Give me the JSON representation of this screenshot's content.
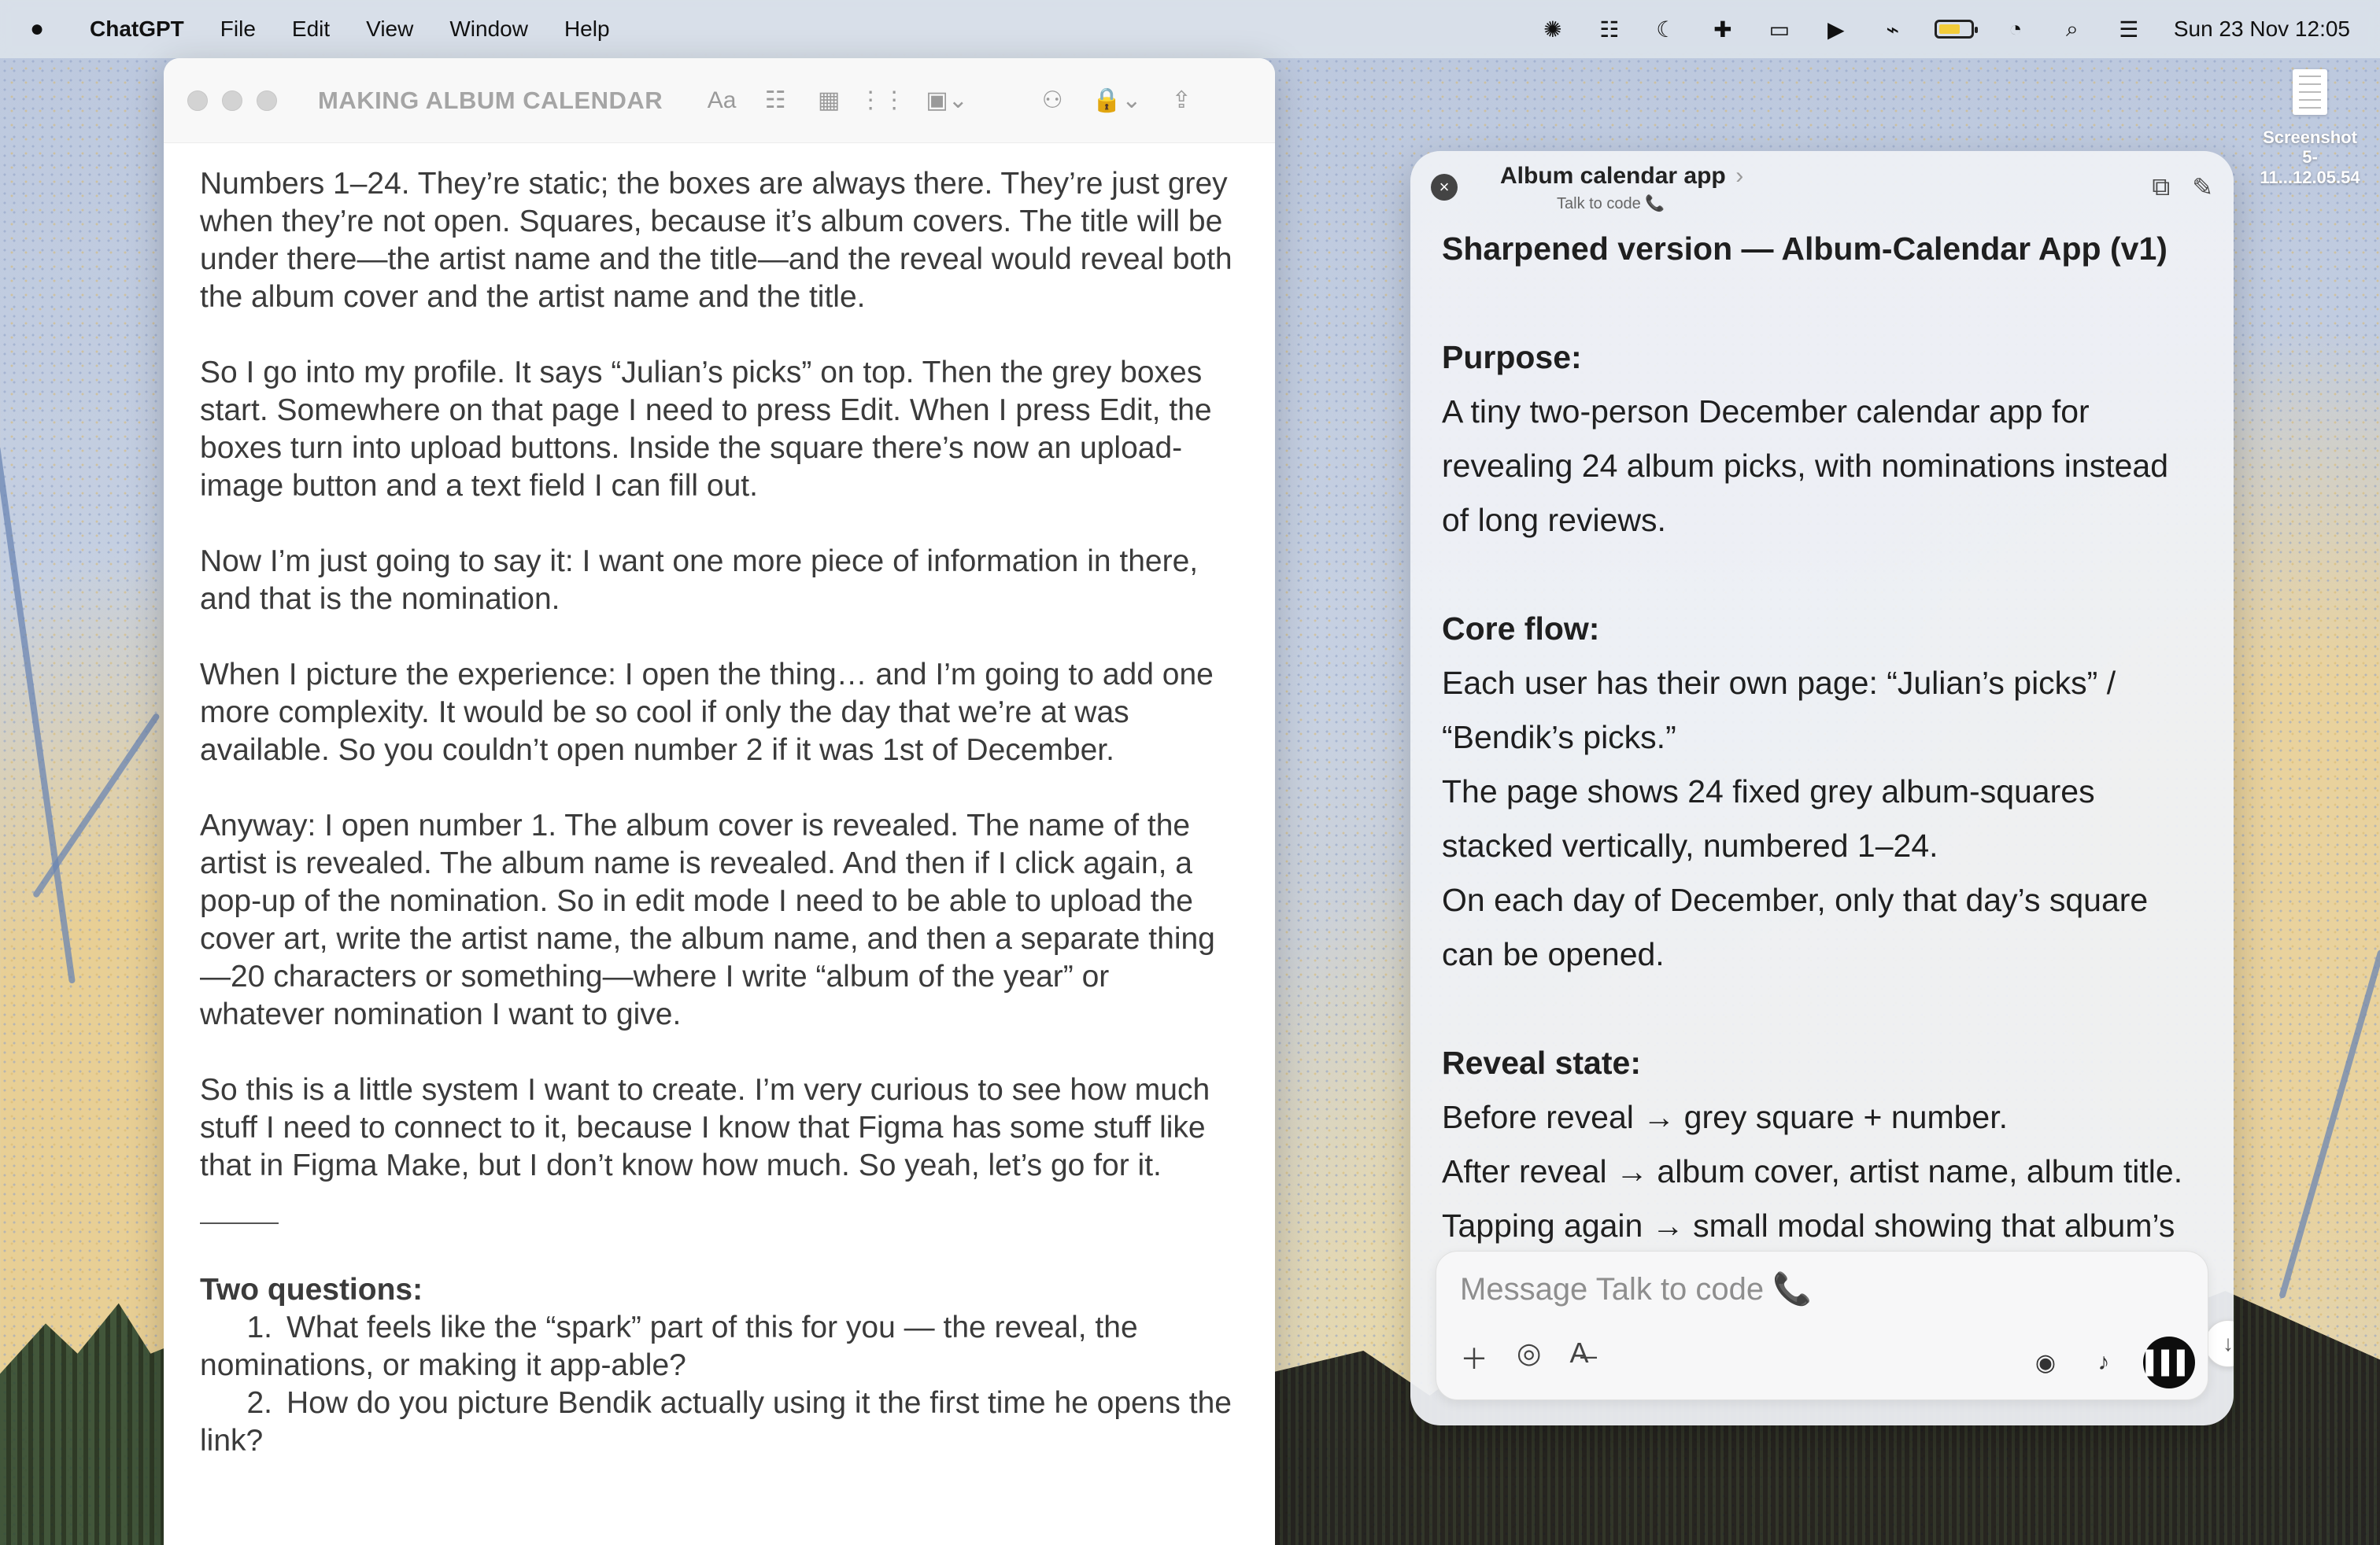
{
  "menubar": {
    "apple": "",
    "app": "ChatGPT",
    "items": [
      "File",
      "Edit",
      "View",
      "Window",
      "Help"
    ],
    "datetime": "Sun 23 Nov  12:05"
  },
  "desktop": {
    "file_label": "Screenshot\n5-11...12.05.54"
  },
  "notes": {
    "title": "MAKING ALBUM CALENDAR",
    "toolbar_icons": [
      "format-icon",
      "checklist-icon",
      "table-icon",
      "audio-icon",
      "media-icon",
      "collaborate-icon",
      "lock-icon",
      "share-icon"
    ],
    "paragraphs": [
      "Numbers 1–24. They’re static; the boxes are always there. They’re just grey when they’re not open. Squares, because it’s album covers. The title will be under there—the artist name and the title—and the reveal would reveal both the album cover and the artist name and the title.",
      "So I go into my profile. It says “Julian’s picks” on top. Then the grey boxes start. Somewhere on that page I need to press Edit. When I press Edit, the boxes turn into upload buttons. Inside the square there’s now an upload-image button and a text field I can fill out.",
      "Now I’m just going to say it: I want one more piece of information in there, and that is the nomination.",
      "When I picture the experience: I open the thing… and I’m going to add one more complexity. It would be so cool if only the day that we’re at was available. So you couldn’t open number 2 if it was 1st of December.",
      "Anyway: I open number 1. The album cover is revealed. The name of the artist is revealed. The album name is revealed. And then if I click again, a pop-up of the nomination. So in edit mode I need to be able to upload the cover art, write the artist name, the album name, and then a separate thing —20 characters or something—where I write “album of the year” or whatever nomination I want to give.",
      "So this is a little system I want to create. I’m very curious to see how much stuff I need to connect to it, because I know that Figma has some stuff like that in Figma Make, but I don’t know how much. So yeah, let’s go for it."
    ],
    "questions_title": "Two questions:",
    "questions": [
      {
        "num": "1.",
        "text": "What feels like the “spark” part of this for you — the reveal, the nominations, or making it app-able?"
      },
      {
        "num": "2.",
        "text": "How do you picture Bendik actually using it the first time he opens the link?"
      }
    ]
  },
  "chat": {
    "title": "Album calendar app",
    "title_chevron": "›",
    "subtitle": "Talk to code 📞",
    "content": {
      "heading": "Sharpened version — Album-Calendar App (v1)",
      "purpose_title": "Purpose:",
      "purpose_text": "A tiny two-person December calendar app for revealing 24 album picks, with nominations instead of long reviews.",
      "core_title": "Core flow:",
      "core_1": "Each user has their own page: “Julian’s picks” / “Bendik’s picks.”",
      "core_2": "The page shows 24 fixed grey album-squares stacked vertically, numbered 1–24.",
      "core_3": "On each day of December, only that day’s square can be opened.",
      "reveal_title": "Reveal state:",
      "reveal_1": "Before reveal → grey square + number.",
      "reveal_2": "After reveal → album cover, artist name, album title.",
      "reveal_3": "Tapping again → small modal showing that album’s"
    },
    "composer": {
      "placeholder": "Message Talk to code 📞",
      "tools": [
        "plus-icon",
        "globe-icon",
        "text-format-icon"
      ],
      "right_tools": [
        "record-icon",
        "microphone-icon",
        "voice-mode-icon"
      ]
    }
  }
}
